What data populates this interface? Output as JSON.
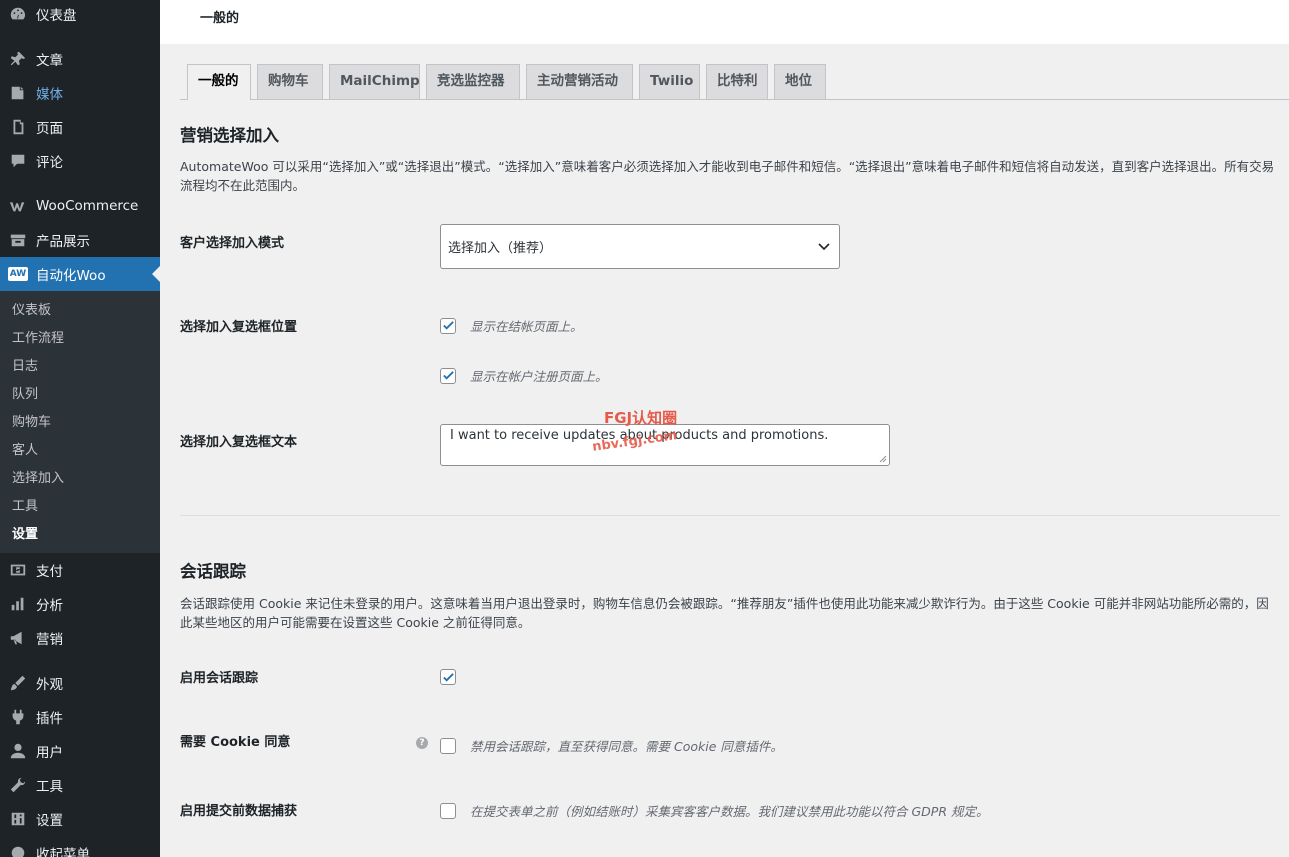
{
  "sidebar": {
    "items": [
      {
        "label": "仪表盘",
        "icon": "dashboard-icon"
      },
      {
        "label": "文章",
        "icon": "pin-icon"
      },
      {
        "label": "媒体",
        "icon": "media-icon"
      },
      {
        "label": "页面",
        "icon": "page-icon"
      },
      {
        "label": "评论",
        "icon": "comment-icon"
      },
      {
        "label": "WooCommerce",
        "icon": "woo-icon"
      },
      {
        "label": "产品展示",
        "icon": "archive-icon"
      },
      {
        "label": "自动化Woo",
        "icon": "aw-icon",
        "badge": "AW"
      }
    ],
    "submenu": [
      "仪表板",
      "工作流程",
      "日志",
      "队列",
      "购物车",
      "客人",
      "选择加入",
      "工具",
      "设置"
    ],
    "items_after": [
      {
        "label": "支付",
        "icon": "payment-icon"
      },
      {
        "label": "分析",
        "icon": "bar-chart-icon"
      },
      {
        "label": "营销",
        "icon": "megaphone-icon"
      },
      {
        "label": "外观",
        "icon": "brush-icon"
      },
      {
        "label": "插件",
        "icon": "plugin-icon"
      },
      {
        "label": "用户",
        "icon": "user-icon"
      },
      {
        "label": "工具",
        "icon": "wrench-icon"
      },
      {
        "label": "设置",
        "icon": "settings-icon"
      },
      {
        "label": "收起菜单",
        "icon": "collapse-icon"
      }
    ]
  },
  "header": {
    "title": "一般的"
  },
  "tabs": [
    "一般的",
    "购物车",
    "MailChimp",
    "竞选监控器",
    "主动营销活动",
    "Twilio",
    "比特利",
    "地位"
  ],
  "optin": {
    "title": "营销选择加入",
    "description": "AutomateWoo 可以采用“选择加入”或“选择退出”模式。“选择加入”意味着客户必须选择加入才能收到电子邮件和短信。“选择退出”意味着电子邮件和短信将自动发送，直到客户选择退出。所有交易流程均不在此范围内。",
    "mode_label": "客户选择加入模式",
    "mode_value": "选择加入（推荐）",
    "checkbox_position_label": "选择加入复选框位置",
    "checkbox_checkout": {
      "label": "显示在结帐页面上。",
      "checked": true
    },
    "checkbox_register": {
      "label": "显示在帐户注册页面上。",
      "checked": true
    },
    "checkbox_text_label": "选择加入复选框文本",
    "checkbox_text_value": "I want to receive updates about products and promotions."
  },
  "session": {
    "title": "会话跟踪",
    "description": "会话跟踪使用 Cookie 来记住未登录的用户。这意味着当用户退出登录时，购物车信息仍会被跟踪。“推荐朋友”插件也使用此功能来减少欺诈行为。由于这些 Cookie 可能并非网站功能所必需的，因此某些地区的用户可能需要在设置这些 Cookie 之前征得同意。",
    "enable_label": "启用会话跟踪",
    "enable_checked": true,
    "cookie_consent_label": "需要 Cookie 同意",
    "cookie_consent_desc": "禁用会话跟踪，直至获得同意。需要 Cookie 同意插件。",
    "cookie_consent_checked": false,
    "presubmit_label": "启用提交前数据捕获",
    "presubmit_desc": "在提交表单之前（例如结账时）采集宾客客户数据。我们建议禁用此功能以符合 GDPR 规定。",
    "presubmit_checked": false
  },
  "watermark": {
    "line1": "FGJ认知圈",
    "line2": "nbv.fgj.com"
  },
  "colors": {
    "sidebar_bg": "#1d2327",
    "accent": "#2271b1",
    "checkbox": "#2271b1"
  }
}
